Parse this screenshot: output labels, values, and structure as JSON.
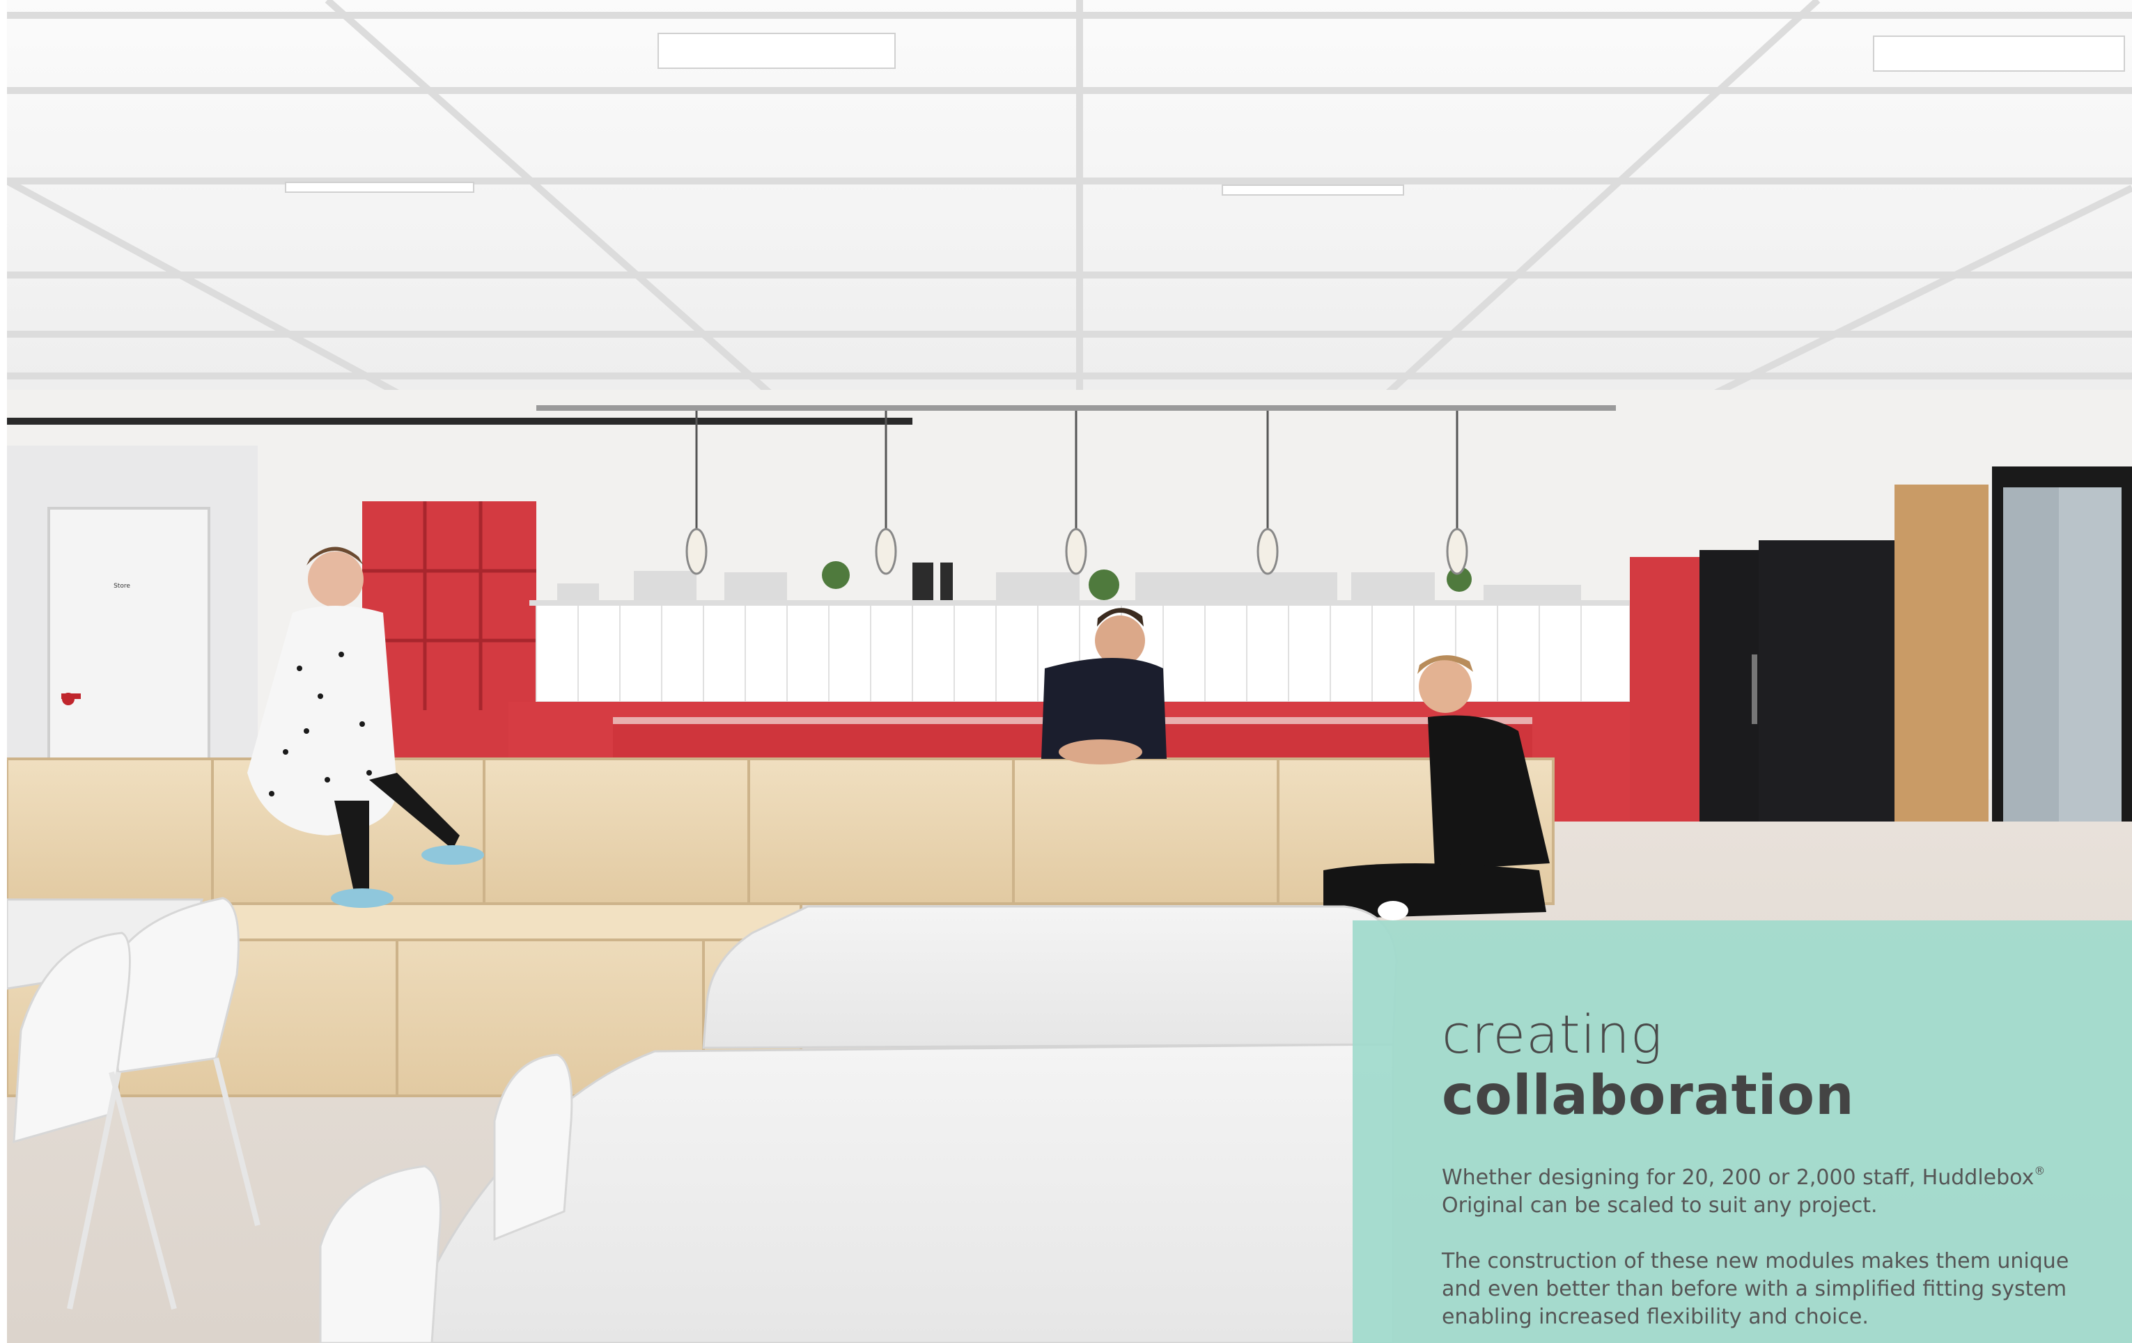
{
  "photo": {
    "description_icon": "office-canteen-photo",
    "door_sign": "Store",
    "colors": {
      "ceiling": "#f7f7f7",
      "kitchen_red": "#d93a42",
      "plywood": "#e9d6b4",
      "fridge": "#1b1b1d",
      "floor": "#e4ddd6",
      "table": "#efefef"
    }
  },
  "panel": {
    "heading_light": "creating",
    "heading_bold": "collaboration",
    "paragraph1_before": "Whether designing for 20, 200 or 2,000 staff, Huddlebox",
    "paragraph1_reg": "®",
    "paragraph1_after": " Original can be scaled to suit any project.",
    "paragraph2": "The construction of these new modules makes them unique and even better than before with a simplified fitting system enabling increased flexibility and choice.",
    "background_color": "#a0dacc"
  }
}
